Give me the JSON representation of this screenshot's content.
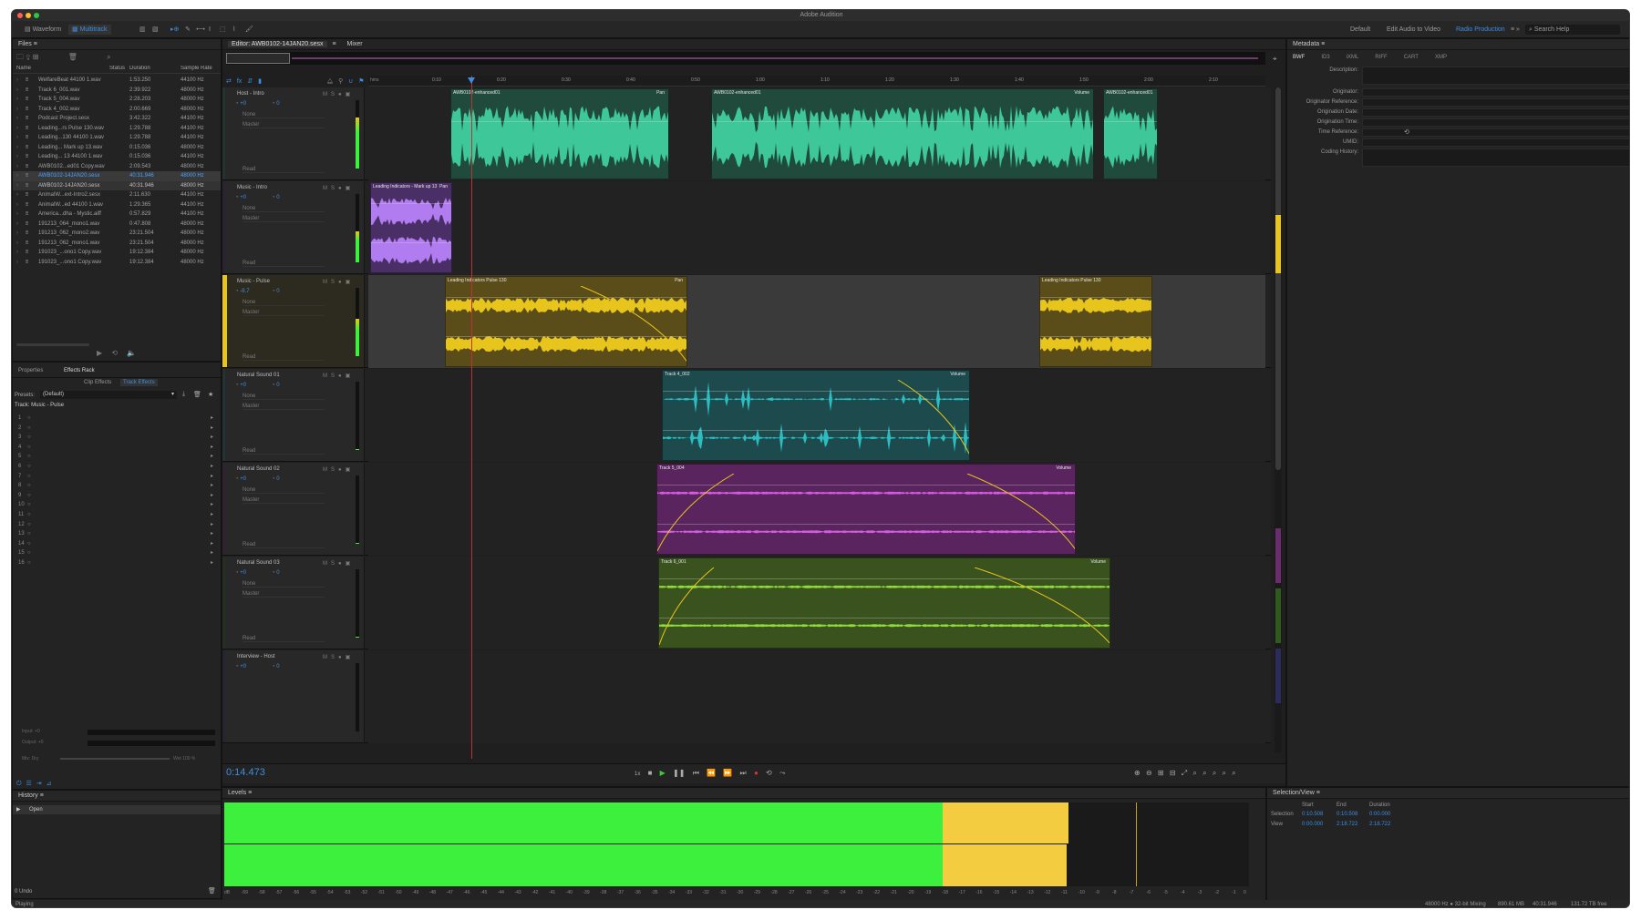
{
  "app": {
    "title": "Adobe Audition"
  },
  "toolbar": {
    "waveform": "Waveform",
    "multitrack": "Multitrack",
    "workspaces": [
      "Default",
      "Edit Audio to Video",
      "Radio Production"
    ],
    "search_placeholder": "Search Help"
  },
  "files": {
    "title": "Files",
    "columns": [
      "Name",
      "Status",
      "Duration",
      "Sample Rate"
    ],
    "items": [
      {
        "name": "WelfareBeat 44100 1.wav",
        "duration": "1:53.250",
        "rate": "44100 Hz"
      },
      {
        "name": "Track 6_001.wav",
        "duration": "2:39.922",
        "rate": "48000 Hz"
      },
      {
        "name": "Track 5_004.wav",
        "duration": "2:28.203",
        "rate": "48000 Hz"
      },
      {
        "name": "Track 4_002.wav",
        "duration": "2:00.669",
        "rate": "48000 Hz"
      },
      {
        "name": "Podcast Project.sesx",
        "duration": "3:42.322",
        "rate": "44100 Hz"
      },
      {
        "name": "Leading...rs Pulse 130.wav",
        "duration": "1:29.788",
        "rate": "44100 Hz"
      },
      {
        "name": "Leading...130 44100 1.wav",
        "duration": "1:29.788",
        "rate": "44100 Hz"
      },
      {
        "name": "Leading... Mark up 13.wav",
        "duration": "0:15.036",
        "rate": "48000 Hz"
      },
      {
        "name": "Leading... 13 44100 1.wav",
        "duration": "0:15.036",
        "rate": "44100 Hz"
      },
      {
        "name": "AWB0102...ed01 Copy.wav",
        "duration": "2:09.543",
        "rate": "48000 Hz"
      },
      {
        "name": "AWB0102-14JAN20.sesx",
        "duration": "40:31.946",
        "rate": "48000 Hz"
      },
      {
        "name": "AWB0102-14JAN20.sesx",
        "duration": "40:31.946",
        "rate": "48000 Hz"
      },
      {
        "name": "AnimalW...ext-Intro2.sesx",
        "duration": "2:11.630",
        "rate": "44100 Hz"
      },
      {
        "name": "AnimalW...ed 44100 1.wav",
        "duration": "1:29.365",
        "rate": "44100 Hz"
      },
      {
        "name": "America...dha - Mystic.aiff",
        "duration": "0:57.829",
        "rate": "44100 Hz"
      },
      {
        "name": "191213_064_mono1.wav",
        "duration": "0:47.808",
        "rate": "48000 Hz"
      },
      {
        "name": "191213_062_mono2.wav",
        "duration": "23:21.504",
        "rate": "48000 Hz"
      },
      {
        "name": "191213_062_mono1.wav",
        "duration": "23:21.504",
        "rate": "48000 Hz"
      },
      {
        "name": "191023_...ono1 Copy.wav",
        "duration": "19:12.384",
        "rate": "48000 Hz"
      },
      {
        "name": "191023_...ono1 Copy.wav",
        "duration": "19:12.384",
        "rate": "48000 Hz"
      }
    ]
  },
  "effects": {
    "tabs": [
      "Properties",
      "Effects Rack"
    ],
    "subtabs": [
      "Clip Effects",
      "Track Effects"
    ],
    "presets_label": "Presets:",
    "preset": "(Default)",
    "track_label": "Track: Music - Pulse",
    "slots": [
      "1",
      "2",
      "3",
      "4",
      "5",
      "6",
      "7",
      "8",
      "9",
      "10",
      "11",
      "12",
      "13",
      "14",
      "15",
      "16"
    ],
    "input": "Input:",
    "output": "Output:",
    "mix": "Mix:",
    "dry": "Dry",
    "wet": "Wet",
    "pct": "100 %",
    "io_values": [
      "+0",
      "+0"
    ]
  },
  "history": {
    "title": "History",
    "item": "Open",
    "undos": "0 Undo",
    "status": "Playing"
  },
  "editor": {
    "tab": "Editor: AWB0102-14JAN20.sesx",
    "mixer": "Mixer",
    "time_unit": "hms",
    "ruler": [
      "0:10",
      "0:20",
      "0:30",
      "0:40",
      "0:50",
      "1:00",
      "1:10",
      "1:20",
      "1:30",
      "1:40",
      "1:50",
      "2:00",
      "2:10"
    ],
    "timecode": "0:14.473",
    "speed": "1x"
  },
  "tracks": [
    {
      "name": "Host - Intro",
      "vol": "+0",
      "pan": "0",
      "in": "None",
      "out": "Master",
      "mode": "Read",
      "clips": [
        {
          "label": "AWB0102-enhanced01",
          "right": "Pan"
        },
        {
          "label": "AWB0102-enhanced01",
          "right": "Volume"
        },
        {
          "label": "AWB0102-enhanced01",
          "right": ""
        }
      ]
    },
    {
      "name": "Music - Intro",
      "vol": "+0",
      "pan": "0",
      "in": "None",
      "out": "Master",
      "mode": "Read",
      "clips": [
        {
          "label": "Leading Indicators - Mark up 13",
          "right": "Pan"
        }
      ]
    },
    {
      "name": "Music - Pulse",
      "vol": "-8.7",
      "pan": "0",
      "in": "None",
      "out": "Master",
      "mode": "Read",
      "clips": [
        {
          "label": "Leading Indicators Pulse 130",
          "right": "Pan"
        },
        {
          "label": "Leading Indicators Pulse 130",
          "right": ""
        }
      ]
    },
    {
      "name": "Natural Sound 01",
      "vol": "+0",
      "pan": "0",
      "in": "None",
      "out": "Master",
      "mode": "Read",
      "clips": [
        {
          "label": "Track 4_002",
          "right": "Volume"
        }
      ]
    },
    {
      "name": "Natural Sound 02",
      "vol": "+0",
      "pan": "0",
      "in": "None",
      "out": "Master",
      "mode": "Read",
      "clips": [
        {
          "label": "Track 5_004",
          "right": "Volume"
        }
      ]
    },
    {
      "name": "Natural Sound 03",
      "vol": "+0",
      "pan": "0",
      "in": "None",
      "out": "Master",
      "mode": "Read",
      "clips": [
        {
          "label": "Track 6_001",
          "right": "Volume"
        }
      ]
    },
    {
      "name": "Interview - Host",
      "vol": "+0",
      "pan": "0",
      "in": "",
      "out": "",
      "mode": "",
      "clips": []
    }
  ],
  "levels": {
    "title": "Levels",
    "scale": [
      "dB",
      "-59",
      "-58",
      "-57",
      "-56",
      "-55",
      "-54",
      "-53",
      "-52",
      "-51",
      "-50",
      "-49",
      "-48",
      "-47",
      "-46",
      "-45",
      "-44",
      "-43",
      "-42",
      "-41",
      "-40",
      "-39",
      "-38",
      "-37",
      "-36",
      "-35",
      "-34",
      "-33",
      "-32",
      "-31",
      "-30",
      "-29",
      "-28",
      "-27",
      "-26",
      "-25",
      "-24",
      "-23",
      "-22",
      "-21",
      "-20",
      "-19",
      "-18",
      "-17",
      "-16",
      "-15",
      "-14",
      "-13",
      "-12",
      "-11",
      "-10",
      "-9",
      "-8",
      "-7",
      "-6",
      "-5",
      "-4",
      "-3",
      "-2",
      "-1",
      "0"
    ]
  },
  "metadata": {
    "title": "Metadata",
    "tabs": [
      "BWF",
      "ID3",
      "iXML",
      "RIFF",
      "CART",
      "XMP"
    ],
    "fields": [
      "Description:",
      "Originator:",
      "Originator Reference:",
      "Origination Date:",
      "Origination Time:",
      "Time Reference:",
      "UMID:",
      "Coding History:"
    ]
  },
  "selection": {
    "title": "Selection/View",
    "headers": [
      "Start",
      "End",
      "Duration"
    ],
    "rows": [
      {
        "label": "Selection",
        "start": "0:10.508",
        "end": "0:10.508",
        "dur": "0:00.000"
      },
      {
        "label": "View",
        "start": "0:00.000",
        "end": "2:18.722",
        "dur": "2:18.722"
      }
    ]
  },
  "status": {
    "format": "48000 Hz ● 32-bit Mixing",
    "mem": "890.61 MB",
    "length": "40:31.946",
    "free": "131.72 TB free"
  },
  "colors": {
    "green": "#3ec89a",
    "purple": "#b07cf0",
    "yellow": "#e8c51c",
    "teal": "#2dbcc0",
    "magenta": "#d45ae0",
    "lime": "#8edc3a",
    "meter": "#3ef03e",
    "meter_peak": "#f4cc40",
    "accent": "#3b8ee0"
  }
}
